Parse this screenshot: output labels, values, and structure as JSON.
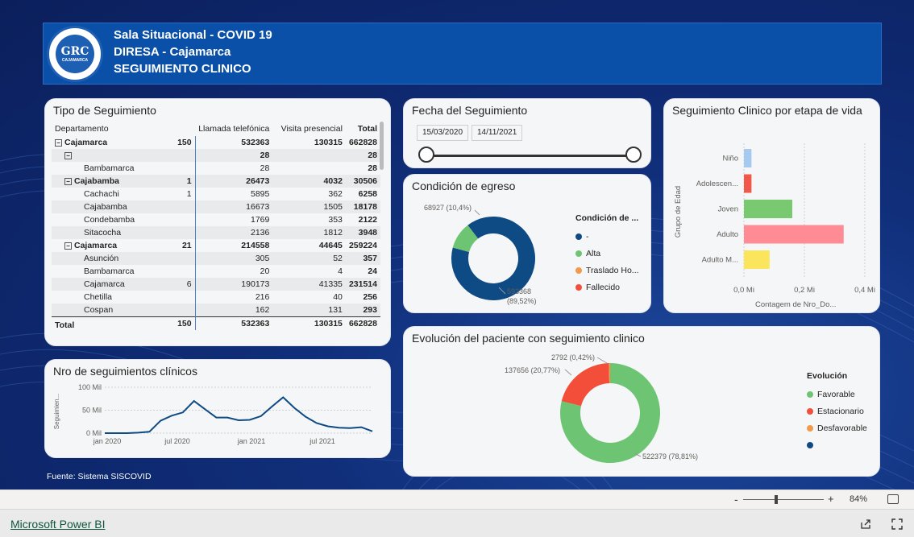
{
  "header": {
    "line1": "Sala Situacional - COVID 19",
    "line2": "DIRESA  - Cajamarca",
    "line3": "SEGUIMIENTO CLINICO",
    "logo_text": "GRC",
    "logo_sub": "CAJAMARCA"
  },
  "footer_source": "Fuente: Sistema SISCOVID",
  "matrix": {
    "title": "Tipo de Seguimiento",
    "columns": [
      "Departamento",
      "",
      "Llamada telefónica",
      "Visita presencial",
      "Total"
    ],
    "rows": [
      {
        "label": "Cajamarca",
        "level": 0,
        "expand": "⊟",
        "c1": "150",
        "c2": "532363",
        "c3": "130315",
        "total": "662828",
        "bold": true
      },
      {
        "label": "",
        "level": 1,
        "expand": "⊟",
        "c1": "",
        "c2": "28",
        "c3": "",
        "total": "28",
        "bold": true
      },
      {
        "label": "Bambamarca",
        "level": 2,
        "expand": "",
        "c1": "",
        "c2": "28",
        "c3": "",
        "total": "28",
        "bold": false
      },
      {
        "label": "Cajabamba",
        "level": 1,
        "expand": "⊟",
        "c1": "1",
        "c2": "26473",
        "c3": "4032",
        "total": "30506",
        "bold": true
      },
      {
        "label": "Cachachi",
        "level": 2,
        "expand": "",
        "c1": "1",
        "c2": "5895",
        "c3": "362",
        "total": "6258",
        "bold": false
      },
      {
        "label": "Cajabamba",
        "level": 2,
        "expand": "",
        "c1": "",
        "c2": "16673",
        "c3": "1505",
        "total": "18178",
        "bold": false
      },
      {
        "label": "Condebamba",
        "level": 2,
        "expand": "",
        "c1": "",
        "c2": "1769",
        "c3": "353",
        "total": "2122",
        "bold": false
      },
      {
        "label": "Sitacocha",
        "level": 2,
        "expand": "",
        "c1": "",
        "c2": "2136",
        "c3": "1812",
        "total": "3948",
        "bold": false
      },
      {
        "label": "Cajamarca",
        "level": 1,
        "expand": "⊟",
        "c1": "21",
        "c2": "214558",
        "c3": "44645",
        "total": "259224",
        "bold": true
      },
      {
        "label": "Asunción",
        "level": 2,
        "expand": "",
        "c1": "",
        "c2": "305",
        "c3": "52",
        "total": "357",
        "bold": false
      },
      {
        "label": "Bambamarca",
        "level": 2,
        "expand": "",
        "c1": "",
        "c2": "20",
        "c3": "4",
        "total": "24",
        "bold": false
      },
      {
        "label": "Cajamarca",
        "level": 2,
        "expand": "",
        "c1": "6",
        "c2": "190173",
        "c3": "41335",
        "total": "231514",
        "bold": false
      },
      {
        "label": "Chetilla",
        "level": 2,
        "expand": "",
        "c1": "",
        "c2": "216",
        "c3": "40",
        "total": "256",
        "bold": false
      },
      {
        "label": "Cospan",
        "level": 2,
        "expand": "",
        "c1": "",
        "c2": "162",
        "c3": "131",
        "total": "293",
        "bold": false
      }
    ],
    "total_row": {
      "label": "Total",
      "c1": "150",
      "c2": "532363",
      "c3": "130315",
      "total": "662828"
    }
  },
  "slicer": {
    "title": "Fecha del Seguimiento",
    "start": "15/03/2020",
    "end": "14/11/2021"
  },
  "chart_data": [
    {
      "type": "pie",
      "title": "Condición de egreso",
      "legend_title": "Condición de ...",
      "labels": [
        "-",
        "Alta",
        "Traslado Ho...",
        "Fallecido"
      ],
      "values": [
        593368,
        68927,
        0,
        0
      ],
      "colors": [
        "#0e4a84",
        "#6dc573",
        "#f2994a",
        "#f24e3a"
      ],
      "data_labels": [
        {
          "text": "593368",
          "pct": "(89,52%)"
        },
        {
          "text": "68927 (10,4%)",
          "pct": ""
        }
      ]
    },
    {
      "type": "bar",
      "title": "Seguimiento Clinico por etapa de vida",
      "categories": [
        "Niño",
        "Adolescen...",
        "Joven",
        "Adulto",
        "Adulto M..."
      ],
      "values": [
        0.025,
        0.025,
        0.16,
        0.33,
        0.085
      ],
      "colors": [
        "#a6c9ef",
        "#f2584a",
        "#78c96f",
        "#ff8c94",
        "#fbe55c"
      ],
      "xlabel": "Contagem de Nro_Do...",
      "ylabel": "Grupo de Edad",
      "xticks": [
        "0,0 Mi",
        "0,2 Mi",
        "0,4 Mi"
      ],
      "xlim": [
        0,
        0.4
      ]
    },
    {
      "type": "pie",
      "title": "Evolución del paciente con seguimiento clinico",
      "legend_title": "Evolución",
      "labels": [
        "Favorable",
        "Estacionario",
        "Desfavorable",
        ""
      ],
      "values": [
        522379,
        137656,
        2792,
        0
      ],
      "colors": [
        "#6dc573",
        "#f24e3a",
        "#f2994a",
        "#0e4a84"
      ],
      "data_labels": [
        "522379 (78,81%)",
        "137656 (20,77%)",
        "2792 (0,42%)"
      ]
    },
    {
      "type": "line",
      "title": "Nro de seguimientos clínicos",
      "ylabel": "Seguimien...",
      "yticks": [
        "100 Mil",
        "50 Mil",
        "0 Mil"
      ],
      "ylim": [
        0,
        100
      ],
      "xticks": [
        "jan 2020",
        "jul 2020",
        "jan 2021",
        "jul 2021"
      ],
      "x": [
        0,
        1,
        2,
        3,
        4,
        5,
        6,
        7,
        8,
        9,
        10,
        11,
        12,
        13,
        14,
        15,
        16,
        17,
        18,
        19,
        20,
        21
      ],
      "values": [
        0,
        0,
        0,
        1,
        3,
        27,
        38,
        45,
        70,
        52,
        34,
        34,
        28,
        29,
        37,
        58,
        78,
        55,
        36,
        22,
        15,
        12,
        11,
        13,
        4
      ],
      "color": "#0e4a84"
    }
  ],
  "zoom": {
    "minus": "-",
    "plus": "+",
    "percent": "84%"
  },
  "bottom": {
    "link": "Microsoft Power BI"
  }
}
